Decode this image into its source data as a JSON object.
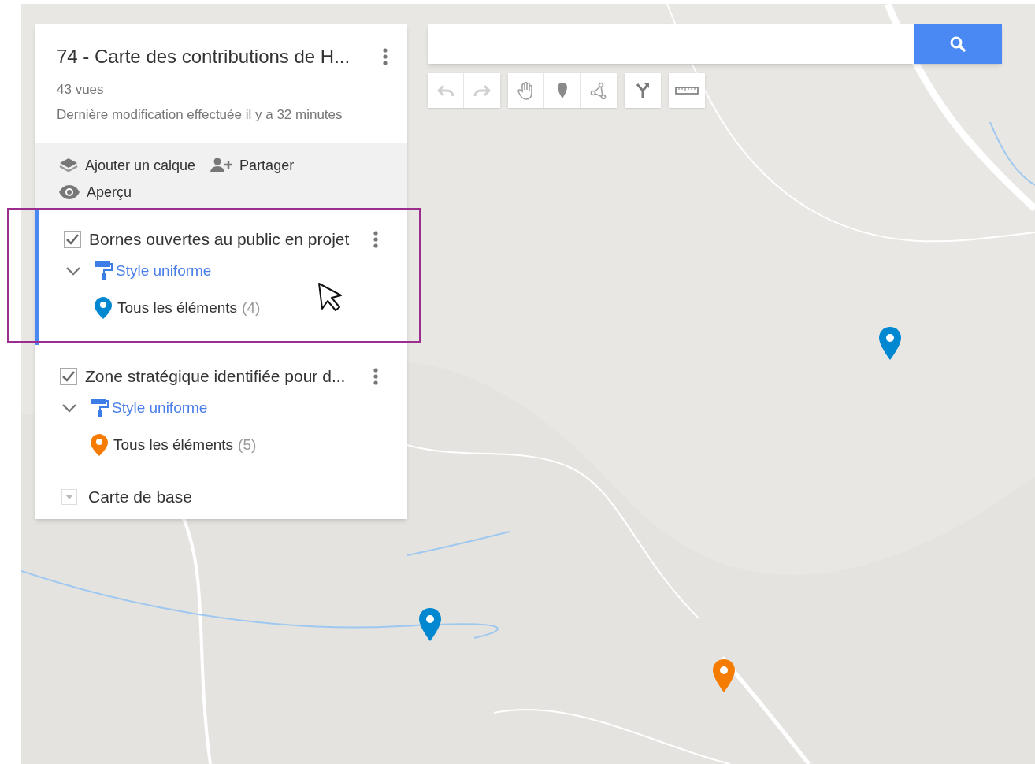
{
  "map": {
    "title": "74 - Carte des contributions de H...",
    "views": "43 vues",
    "modified": "Dernière modification effectuée il y a 32 minutes"
  },
  "actions": [
    {
      "kind": "layers",
      "label": "Ajouter un calque"
    },
    {
      "kind": "share",
      "label": "Partager"
    },
    {
      "kind": "preview",
      "label": "Aperçu"
    }
  ],
  "layers": [
    {
      "title": "Bornes ouvertes au public en projet",
      "checked": true,
      "selected": true,
      "expanded": true,
      "style": "Style uniforme",
      "items": "Tous les éléments",
      "count": "(4)",
      "color": "#0288d1"
    },
    {
      "title": "Zone stratégique identifiée pour d...",
      "checked": true,
      "selected": false,
      "expanded": true,
      "style": "Style uniforme",
      "items": "Tous les éléments",
      "count": "(5)",
      "color": "#f57c00"
    }
  ],
  "base_map": {
    "label": "Carte de base",
    "expanded": false
  },
  "map_pins": [
    {
      "color": "#0288d1"
    },
    {
      "color": "#0288d1"
    },
    {
      "color": "#f57c00"
    }
  ]
}
